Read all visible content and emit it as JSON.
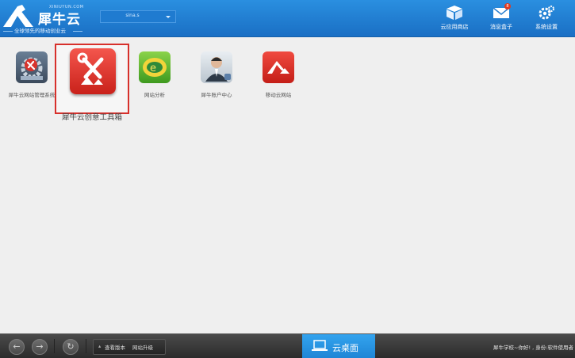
{
  "header": {
    "logo_small": "XINIUYUN.COM",
    "logo_text": "犀牛云",
    "slogan": "全球领先的移动创业云",
    "workspace_value": "sina.s",
    "buttons": [
      {
        "label": "云应用商店",
        "icon": "cube-icon"
      },
      {
        "label": "消息盒子",
        "icon": "envelope-icon",
        "badge": "8"
      },
      {
        "label": "系统设置",
        "icon": "gear-icon"
      }
    ],
    "colors": {
      "header_blue": "#1a6fc4",
      "accent_red": "#d7302b",
      "taskbar_blue": "#1f86d6"
    }
  },
  "desktop": {
    "apps": [
      {
        "name": "犀牛云网站管理系统",
        "icon": "site-manager-icon"
      },
      {
        "name": "犀牛云创意工具箱",
        "icon": "toolbox-icon",
        "selected": true
      },
      {
        "name": "网站分析",
        "icon": "analytics-icon"
      },
      {
        "name": "犀牛账户中心",
        "icon": "account-center-icon"
      },
      {
        "name": "移动云网站",
        "icon": "mobile-site-icon"
      }
    ]
  },
  "taskbar": {
    "back_icon": "arrow-left-icon",
    "forward_icon": "arrow-right-icon",
    "refresh_icon": "refresh-icon",
    "tool_version": "查看版本",
    "tool_upgrade": "网站升级",
    "cloud_desktop": "云桌面",
    "status": "犀牛学校~你好! , 身份:软件使用者"
  }
}
